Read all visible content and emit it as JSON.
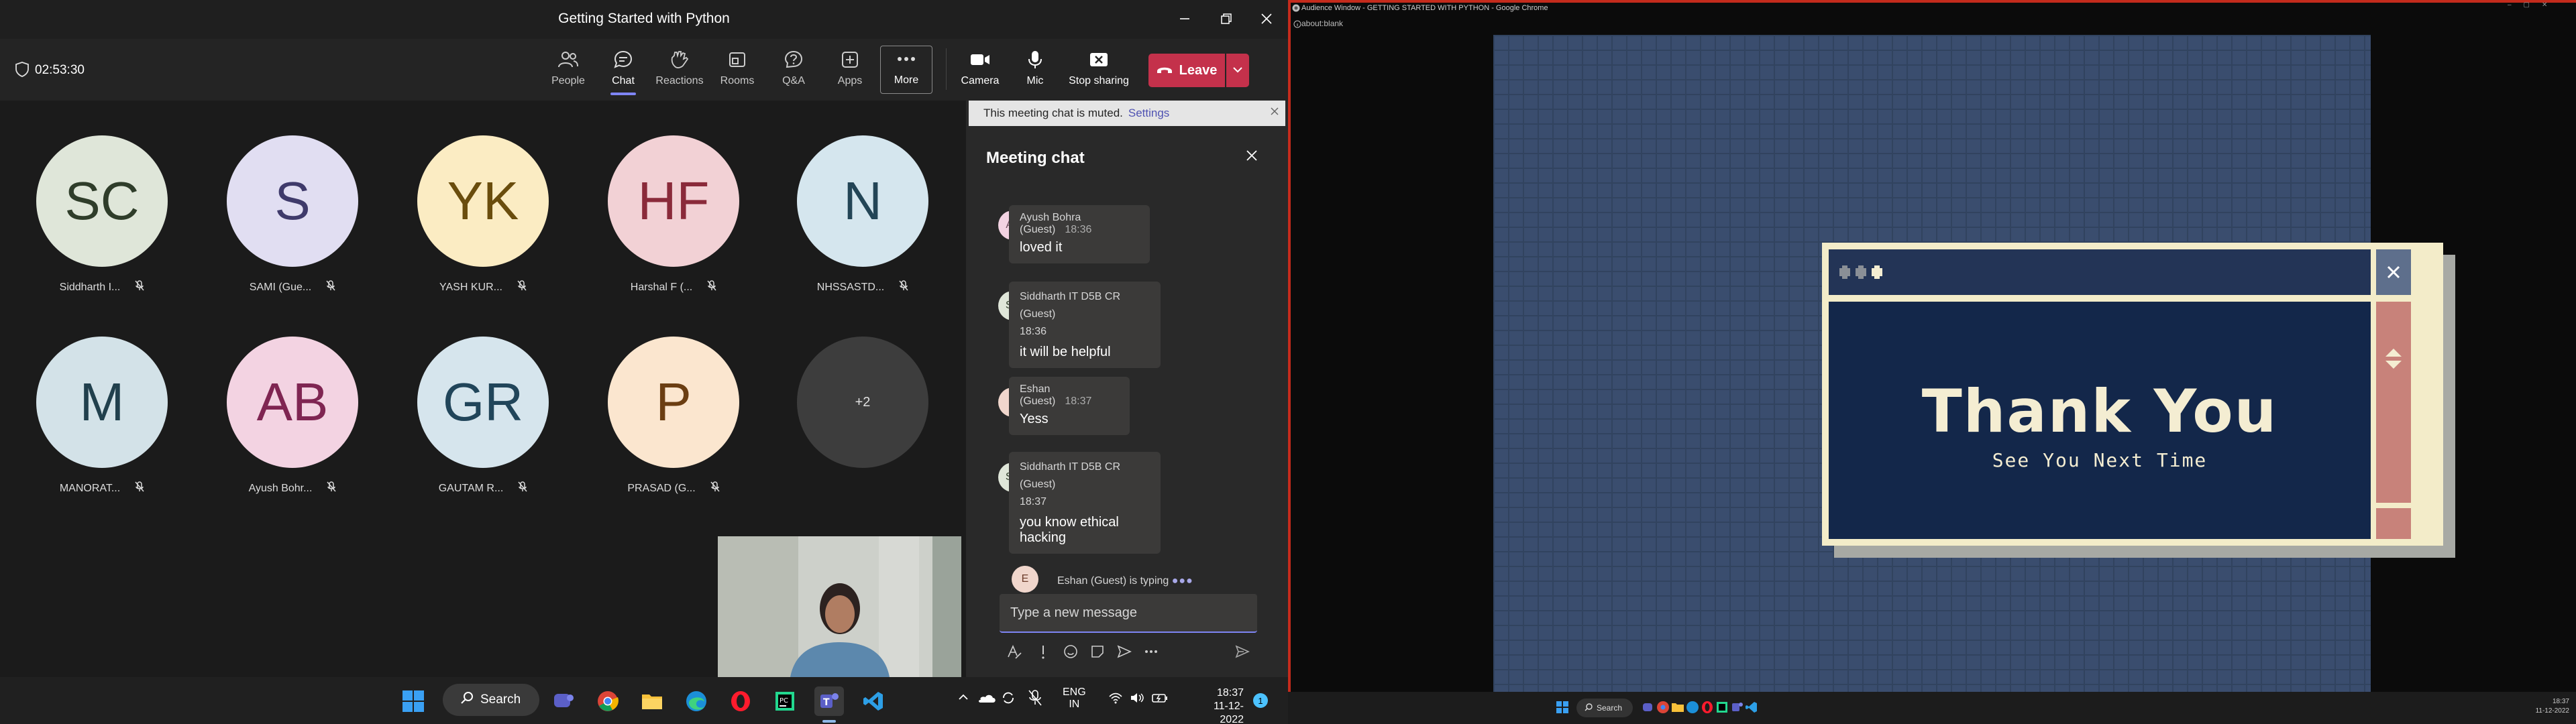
{
  "teams": {
    "window_title": "Getting Started with Python",
    "timer": "02:53:30",
    "toolbar": {
      "people": "People",
      "chat": "Chat",
      "reactions": "Reactions",
      "rooms": "Rooms",
      "qa": "Q&A",
      "apps": "Apps",
      "more": "More",
      "camera": "Camera",
      "mic": "Mic",
      "stop_sharing": "Stop sharing",
      "leave": "Leave"
    },
    "participants": [
      {
        "initials": "SC",
        "name": "Siddharth I...",
        "bg": "#dfe6d9",
        "fg": "#2f3d2a"
      },
      {
        "initials": "S",
        "name": "SAMI (Gue...",
        "bg": "#e1def2",
        "fg": "#3f3a6b"
      },
      {
        "initials": "YK",
        "name": "YASH KUR...",
        "bg": "#fbecc3",
        "fg": "#6a4d0d"
      },
      {
        "initials": "HF",
        "name": "Harshal F (...",
        "bg": "#f2d1d5",
        "fg": "#8a2a3a"
      },
      {
        "initials": "N",
        "name": "NHSSASTD...",
        "bg": "#d5e6ee",
        "fg": "#234556"
      },
      {
        "initials": "M",
        "name": "MANORAT...",
        "bg": "#d3e2e8",
        "fg": "#21404d"
      },
      {
        "initials": "AB",
        "name": "Ayush Bohr...",
        "bg": "#f3d3e2",
        "fg": "#7f2552"
      },
      {
        "initials": "GR",
        "name": "GAUTAM R...",
        "bg": "#d6e5ed",
        "fg": "#21455a"
      },
      {
        "initials": "P",
        "name": "PRASAD (G...",
        "bg": "#fbe6cf",
        "fg": "#6b3e12"
      }
    ],
    "overflow": "+2",
    "chat": {
      "muted_notice": "This meeting chat is muted.",
      "muted_link": "Settings",
      "title": "Meeting chat",
      "messages": [
        {
          "avatar": "AB",
          "sender": "Ayush Bohra (Guest)",
          "time": "18:36",
          "text": "loved it"
        },
        {
          "avatar": "SC",
          "sender": "Siddharth IT D5B CR (Guest)",
          "time": "18:36",
          "text": "it will be helpful"
        },
        {
          "avatar": "E",
          "sender": "Eshan (Guest)",
          "time": "18:37",
          "text": "Yess"
        },
        {
          "avatar": "SC",
          "sender": "Siddharth IT D5B CR (Guest)",
          "time": "18:37",
          "text": "you know ethical hacking"
        }
      ],
      "typing_avatar": "E",
      "typing": "Eshan (Guest) is typing",
      "compose_placeholder": "Type a new message"
    },
    "taskbar": {
      "search": "Search",
      "language_top": "ENG",
      "language_bottom": "IN",
      "time": "18:37",
      "date": "11-12-2022",
      "notifications": "1"
    }
  },
  "chrome": {
    "title": "Audience Window - GETTING STARTED WITH PYTHON - Google Chrome",
    "address": "about:blank",
    "slide": {
      "heading": "Thank You",
      "subheading": "See You Next Time"
    },
    "taskbar": {
      "search": "Search",
      "time": "18:37",
      "date": "11-12-2022"
    }
  }
}
